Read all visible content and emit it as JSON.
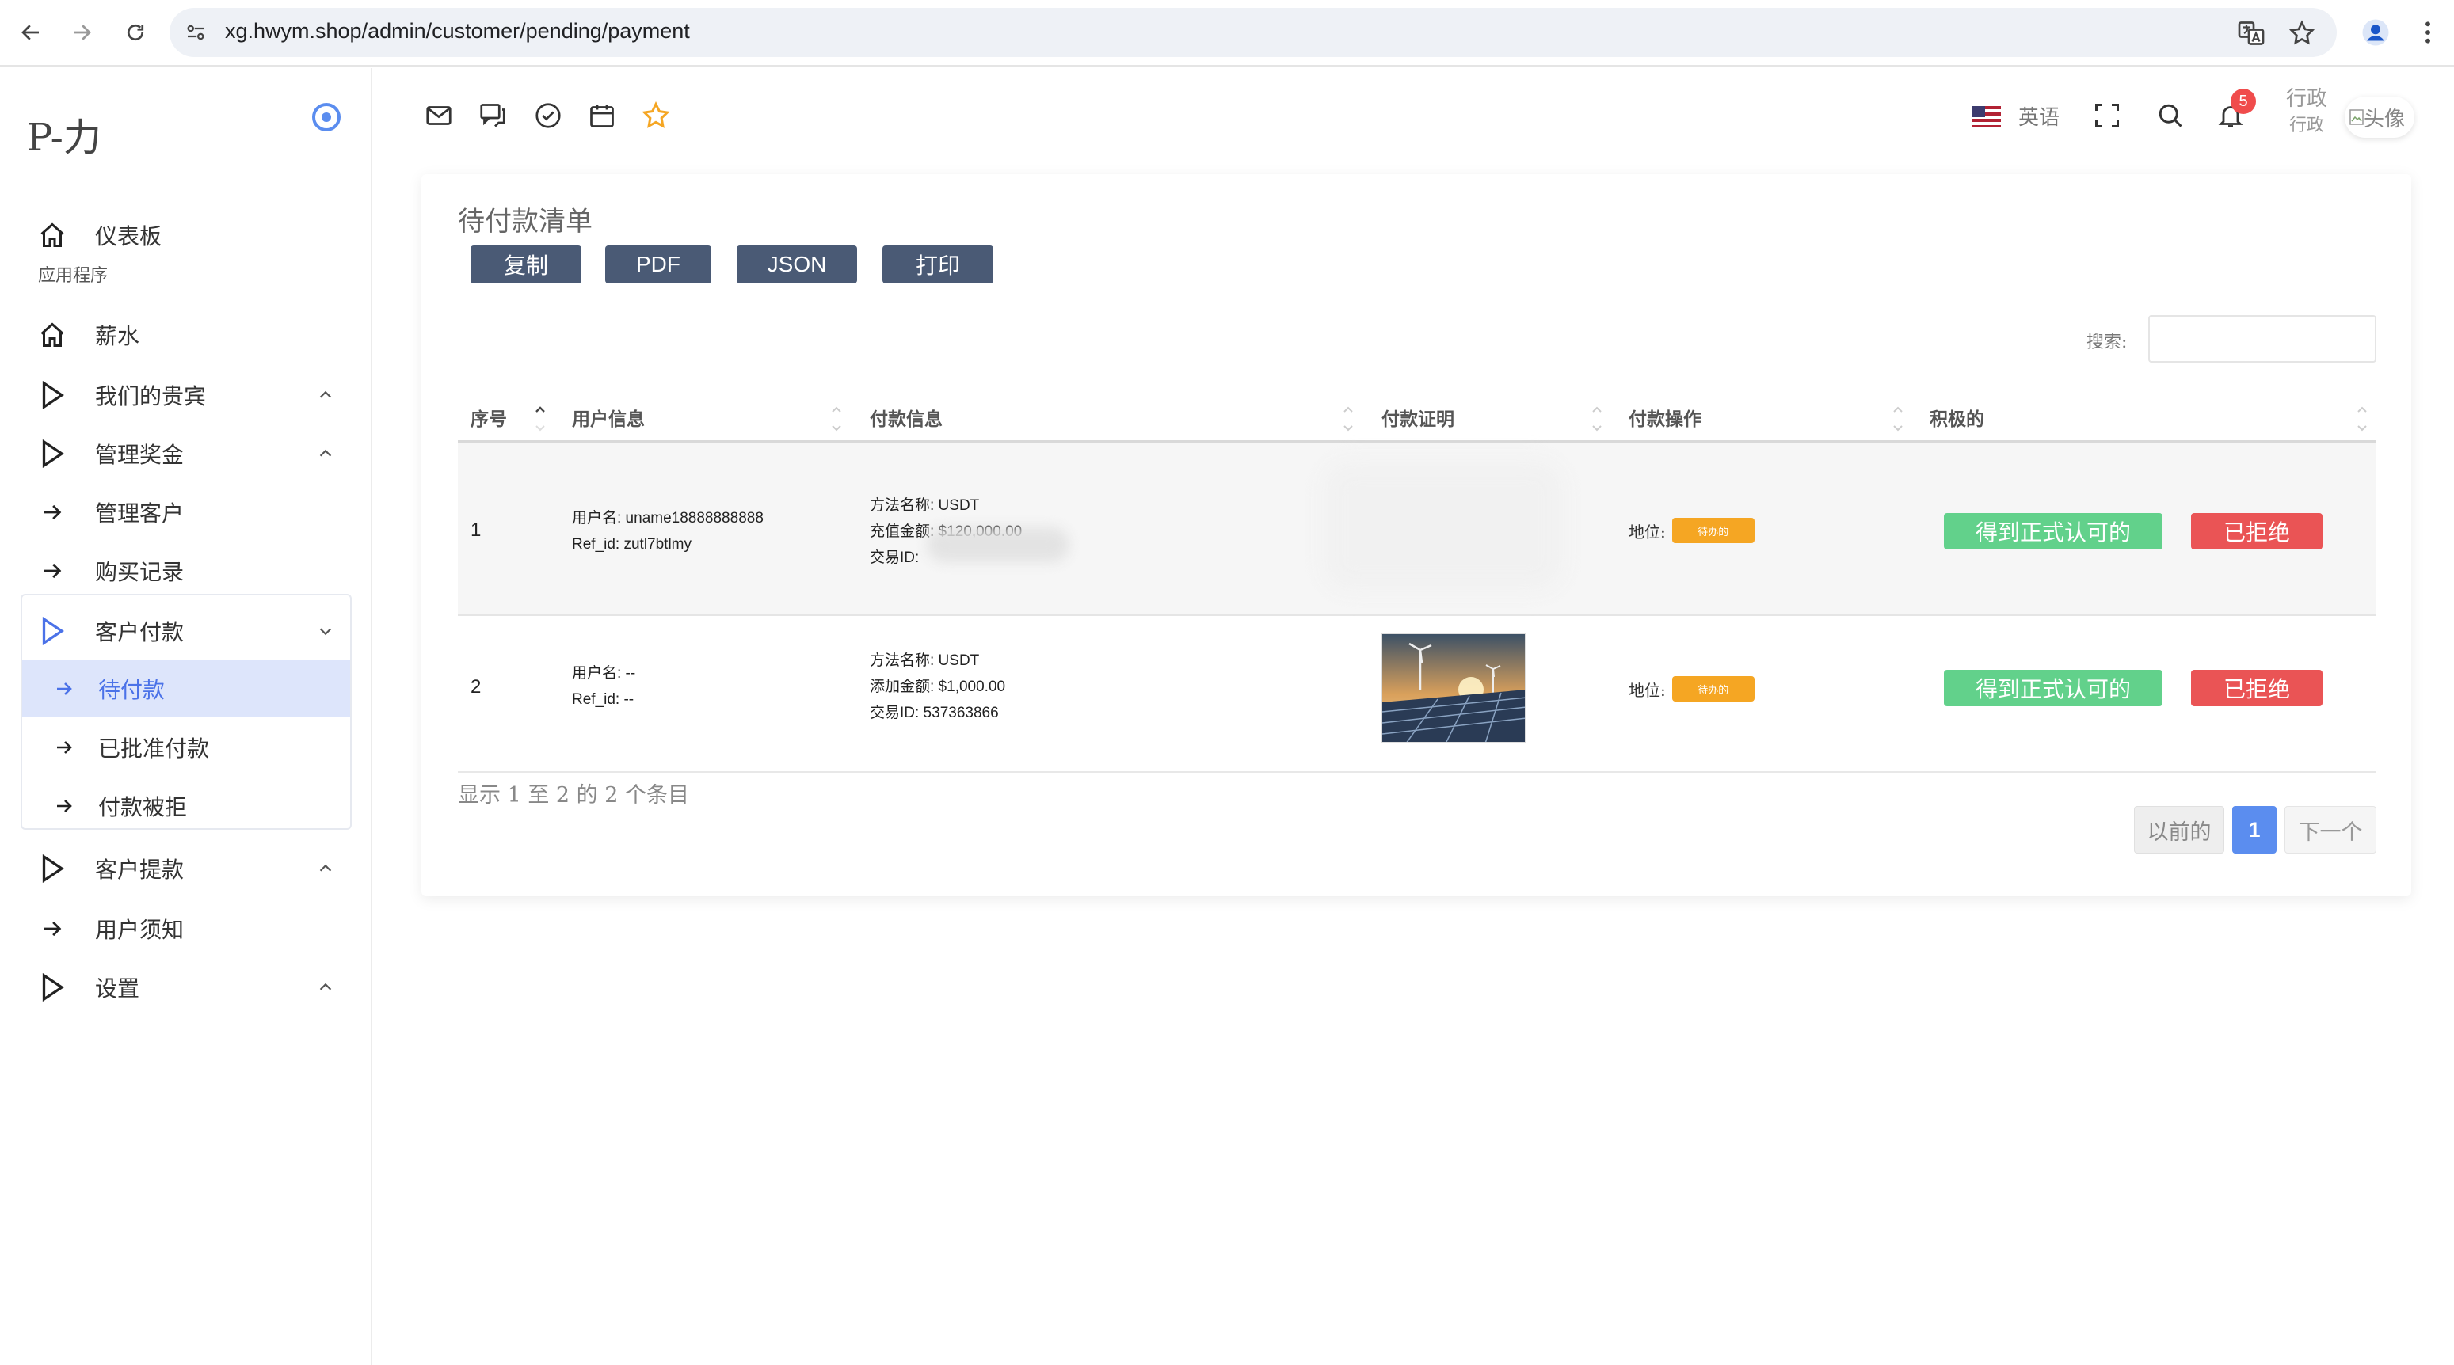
{
  "browser": {
    "url": "xg.hwym.shop/admin/customer/pending/payment"
  },
  "brand": {
    "title": "P-力"
  },
  "sidebar": {
    "dashboard": "仪表板",
    "section_label": "应用程序",
    "items": [
      {
        "label": "薪水"
      },
      {
        "label": "我们的贵宾"
      },
      {
        "label": "管理奖金"
      },
      {
        "label": "管理客户"
      },
      {
        "label": "购买记录"
      },
      {
        "label": "客户付款"
      },
      {
        "label": "客户提款"
      },
      {
        "label": "用户须知"
      },
      {
        "label": "设置"
      }
    ],
    "sub_items": [
      {
        "label": "待付款",
        "active": true
      },
      {
        "label": "已批准付款"
      },
      {
        "label": "付款被拒"
      }
    ]
  },
  "topbar": {
    "language": "英语",
    "notification_count": "5",
    "user_name": "行政",
    "user_role": "行政",
    "avatar_alt": "头像"
  },
  "card": {
    "title": "待付款清单",
    "export_buttons": [
      "复制",
      "PDF",
      "JSON",
      "打印"
    ],
    "search_label": "搜索:",
    "columns": [
      "序号",
      "用户信息",
      "付款信息",
      "付款证明",
      "付款操作",
      "积极的"
    ],
    "rows": [
      {
        "index": "1",
        "username_line": "用户名: uname18888888888",
        "ref_line": "Ref_id: zutl7btlmy",
        "method_line": "方法名称: USDT",
        "amount_line": "充值金额: $120,000.00",
        "txid_line": "交易ID:",
        "status_label": "地位:",
        "status_value": "待办的",
        "approve": "得到正式认可的",
        "reject": "已拒绝"
      },
      {
        "index": "2",
        "username_line": "用户名: --",
        "ref_line": "Ref_id: --",
        "method_line": "方法名称: USDT",
        "amount_line": "添加金额: $1,000.00",
        "txid_line": "交易ID: 537363866",
        "status_label": "地位:",
        "status_value": "待办的",
        "approve": "得到正式认可的",
        "reject": "已拒绝"
      }
    ],
    "info": "显示 1 至 2 的 2 个条目",
    "pagination": {
      "prev": "以前的",
      "current": "1",
      "next": "下一个"
    }
  },
  "colors": {
    "accent": "#5b8def",
    "export_button": "#4a5a75",
    "approve": "#62d18b",
    "reject": "#ea5455",
    "pending": "#f5a623",
    "badge": "#f04c4c"
  },
  "icons": [
    "back-icon",
    "forward-icon",
    "reload-icon",
    "site-settings-icon",
    "translate-icon",
    "bookmark-star-icon",
    "profile-icon",
    "kebab-menu-icon",
    "mail-icon",
    "chat-icon",
    "check-circle-icon",
    "calendar-icon",
    "star-icon",
    "flag-us-icon",
    "fullscreen-icon",
    "search-icon",
    "bell-icon",
    "home-icon",
    "play-icon",
    "arrow-right-icon",
    "chevron-up-icon",
    "chevron-down-icon"
  ]
}
